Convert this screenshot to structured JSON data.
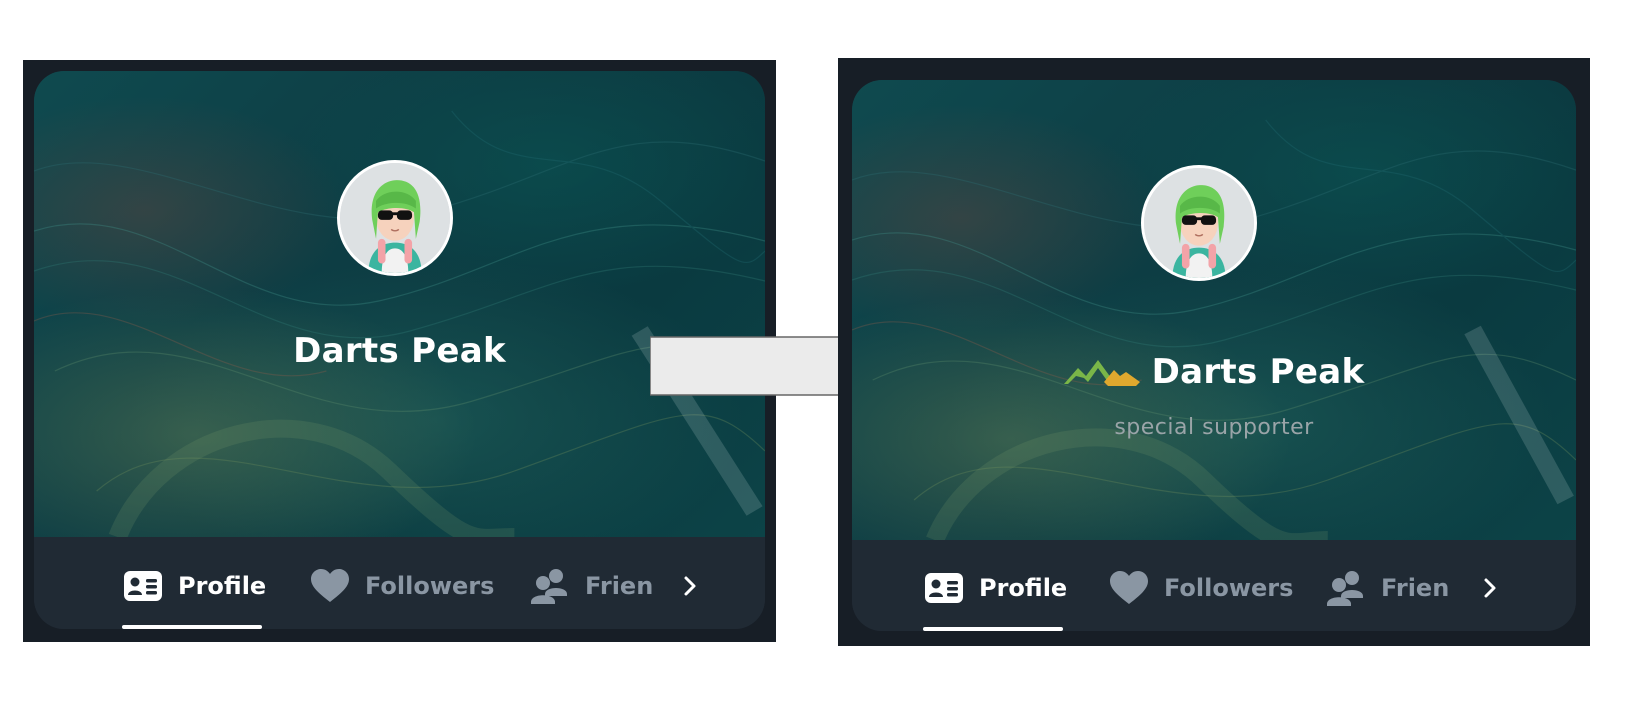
{
  "before": {
    "user": {
      "name": "Darts Peak"
    },
    "nav": {
      "items": [
        {
          "label": "Profile",
          "icon": "profile-card-icon",
          "active": true
        },
        {
          "label": "Followers",
          "icon": "heart-icon",
          "active": false
        },
        {
          "label": "Frien",
          "icon": "friends-icon",
          "active": false
        }
      ],
      "more_icon": "chevron-right-icon"
    }
  },
  "after": {
    "user": {
      "name": "Darts Peak",
      "badge_icon": "mountain-badge-icon",
      "subtitle": "special supporter"
    },
    "nav": {
      "items": [
        {
          "label": "Profile",
          "icon": "profile-card-icon",
          "active": true
        },
        {
          "label": "Followers",
          "icon": "heart-icon",
          "active": false
        },
        {
          "label": "Frien",
          "icon": "friends-icon",
          "active": false
        }
      ],
      "more_icon": "chevron-right-icon"
    }
  },
  "colors": {
    "panel_bg": "#171e26",
    "nav_bg": "#202a34",
    "banner_teal": "#0d3d44",
    "text_active": "#ffffff",
    "text_inactive": "#8a96a3",
    "badge_green": "#7ab648",
    "badge_gold": "#e0a82e",
    "arrow_fill": "#ebebeb"
  }
}
